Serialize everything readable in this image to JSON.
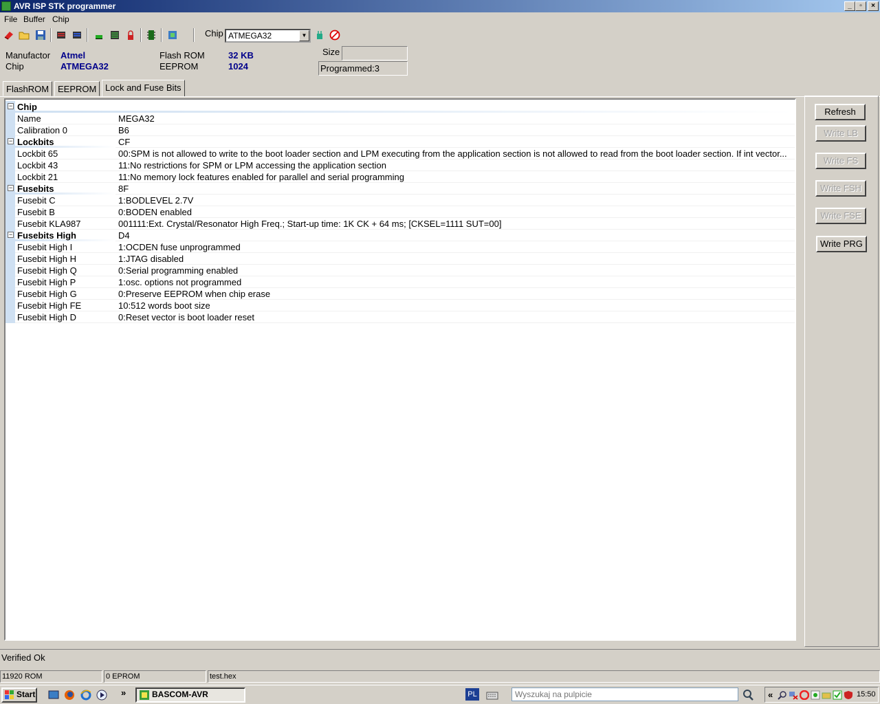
{
  "window": {
    "title": "AVR ISP STK programmer"
  },
  "menu": [
    "File",
    "Buffer",
    "Chip"
  ],
  "toolbar": {
    "chip_label": "Chip",
    "chip_value": "ATMEGA32"
  },
  "info": {
    "manufactor_label": "Manufactor",
    "manufactor_value": "Atmel",
    "chip_label": "Chip",
    "chip_value": "ATMEGA32",
    "flash_label": "Flash ROM",
    "flash_value": "32 KB",
    "eeprom_label": "EEPROM",
    "eeprom_value": "1024",
    "size_label": "Size",
    "size_value": "",
    "programmed": "Programmed:3"
  },
  "tabs": [
    "FlashROM",
    "EEPROM",
    "Lock and Fuse Bits"
  ],
  "active_tab": "Lock and Fuse Bits",
  "grid": {
    "rows": [
      {
        "name": "Chip",
        "value": "",
        "category": true
      },
      {
        "name": "Name",
        "value": "MEGA32"
      },
      {
        "name": "Calibration 0",
        "value": "B6"
      },
      {
        "name": "Lockbits",
        "value": "CF",
        "category": true
      },
      {
        "name": "Lockbit 65",
        "value": "00:SPM is not allowed to write to the boot loader section and LPM executing from the application section is not allowed to read from the boot loader section. If int vector..."
      },
      {
        "name": "Lockbit 43",
        "value": "11:No restrictions for SPM or LPM accessing the application section"
      },
      {
        "name": "Lockbit 21",
        "value": "11:No memory lock features enabled for parallel and serial programming"
      },
      {
        "name": "Fusebits",
        "value": "8F",
        "category": true
      },
      {
        "name": "Fusebit C",
        "value": "1:BODLEVEL 2.7V"
      },
      {
        "name": "Fusebit B",
        "value": "0:BODEN enabled"
      },
      {
        "name": "Fusebit KLA987",
        "value": "001111:Ext. Crystal/Resonator High Freq.; Start-up time: 1K CK + 64 ms; [CKSEL=1111 SUT=00]"
      },
      {
        "name": "Fusebits High",
        "value": "D4",
        "category": true
      },
      {
        "name": "Fusebit High I",
        "value": "1:OCDEN fuse unprogrammed"
      },
      {
        "name": "Fusebit High H",
        "value": "1:JTAG disabled"
      },
      {
        "name": "Fusebit High Q",
        "value": "0:Serial programming enabled"
      },
      {
        "name": "Fusebit High P",
        "value": "1:osc. options not programmed"
      },
      {
        "name": "Fusebit High G",
        "value": "0:Preserve EEPROM when chip erase"
      },
      {
        "name": "Fusebit High FE",
        "value": "10:512 words boot size"
      },
      {
        "name": "Fusebit High D",
        "value": "0:Reset vector is boot loader reset"
      }
    ]
  },
  "buttons": {
    "refresh": "Refresh",
    "write_lb": "Write LB",
    "write_fs": "Write FS",
    "write_fsh": "Write FSH",
    "write_fse": "Write FSE",
    "write_prg": "Write PRG"
  },
  "status": {
    "message": "Verified Ok",
    "rom": "11920 ROM",
    "eprom": "0 EPROM",
    "file": "test.hex"
  },
  "taskbar": {
    "start": "Start",
    "task": "BASCOM-AVR",
    "chevron": "»",
    "lang": "PL",
    "search_placeholder": "Wyszukaj na pulpicie",
    "tray_chevron": "«",
    "clock": "15:50"
  }
}
